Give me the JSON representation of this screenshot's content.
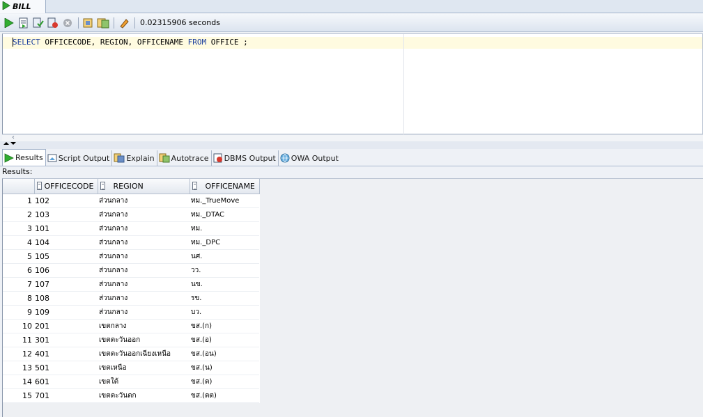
{
  "document_tab": {
    "label": "BILL"
  },
  "toolbar": {
    "timing": "0.02315906 seconds"
  },
  "editor": {
    "kw_select": "SELECT",
    "columns_part": " OFFICECODE, REGION, OFFICENAME ",
    "kw_from": "FROM",
    "table_part": " OFFICE ;"
  },
  "result_tabs": [
    {
      "label": "Results"
    },
    {
      "label": "Script Output"
    },
    {
      "label": "Explain"
    },
    {
      "label": "Autotrace"
    },
    {
      "label": "DBMS Output"
    },
    {
      "label": "OWA Output"
    }
  ],
  "results_label": "Results:",
  "grid": {
    "columns": [
      "OFFICECODE",
      "REGION",
      "OFFICENAME"
    ],
    "rows": [
      {
        "n": "1",
        "code": "102",
        "region": "ส่วนกลาง",
        "name": "ทม._TrueMove"
      },
      {
        "n": "2",
        "code": "103",
        "region": "ส่วนกลาง",
        "name": "ทม._DTAC"
      },
      {
        "n": "3",
        "code": "101",
        "region": "ส่วนกลาง",
        "name": "ทม."
      },
      {
        "n": "4",
        "code": "104",
        "region": "ส่วนกลาง",
        "name": "ทม._DPC"
      },
      {
        "n": "5",
        "code": "105",
        "region": "ส่วนกลาง",
        "name": "นศ."
      },
      {
        "n": "6",
        "code": "106",
        "region": "ส่วนกลาง",
        "name": "วว."
      },
      {
        "n": "7",
        "code": "107",
        "region": "ส่วนกลาง",
        "name": "นข."
      },
      {
        "n": "8",
        "code": "108",
        "region": "ส่วนกลาง",
        "name": "รข."
      },
      {
        "n": "9",
        "code": "109",
        "region": "ส่วนกลาง",
        "name": "บว."
      },
      {
        "n": "10",
        "code": "201",
        "region": "เขตกลาง",
        "name": "ขส.(ก)"
      },
      {
        "n": "11",
        "code": "301",
        "region": "เขตตะวันออก",
        "name": "ขส.(อ)"
      },
      {
        "n": "12",
        "code": "401",
        "region": "เขตตะวันออกเฉียงเหนือ",
        "name": "ขส.(อน)"
      },
      {
        "n": "13",
        "code": "501",
        "region": "เขตเหนือ",
        "name": "ขส.(น)"
      },
      {
        "n": "14",
        "code": "601",
        "region": "เขตใต้",
        "name": "ขส.(ต)"
      },
      {
        "n": "15",
        "code": "701",
        "region": "เขตตะวันตก",
        "name": "ขส.(ตต)"
      }
    ]
  }
}
